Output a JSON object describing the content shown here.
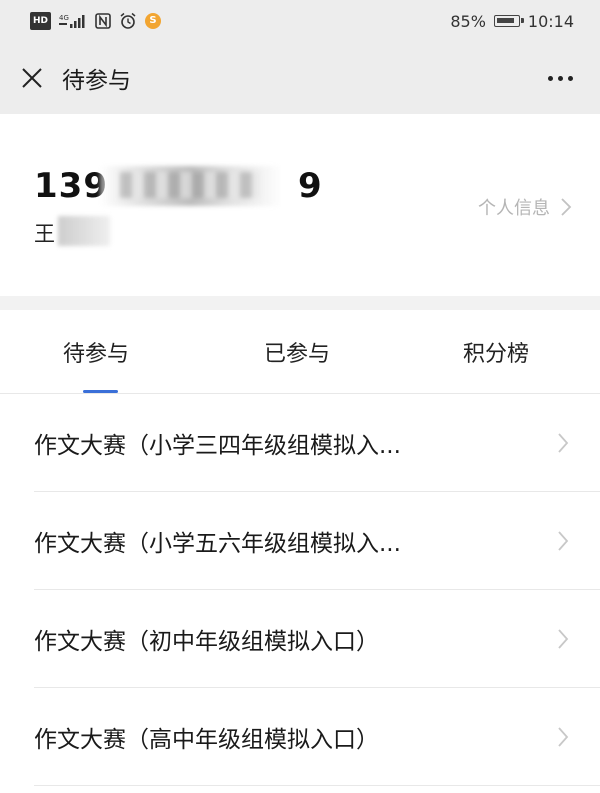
{
  "status_bar": {
    "hd": "HD",
    "network": "4G",
    "nfc": "N",
    "sogou": "S",
    "battery_percent": "85%",
    "time": "10:14"
  },
  "nav": {
    "title": "待参与"
  },
  "profile": {
    "phone_visible": "139",
    "phone_tail": "9",
    "name_visible": "王",
    "info_link": "个人信息"
  },
  "tabs": [
    {
      "label": "待参与",
      "active": true
    },
    {
      "label": "已参与",
      "active": false
    },
    {
      "label": "积分榜",
      "active": false
    }
  ],
  "list_items": [
    {
      "text": "作文大赛（小学三四年级组模拟入..."
    },
    {
      "text": "作文大赛（小学五六年级组模拟入..."
    },
    {
      "text": "作文大赛（初中年级组模拟入口）"
    },
    {
      "text": "作文大赛（高中年级组模拟入口）"
    }
  ],
  "colors": {
    "header_bg": "#ededed",
    "accent": "#3a6fd8",
    "muted_text": "#b5b5b5",
    "divider": "#e8e8e8"
  }
}
